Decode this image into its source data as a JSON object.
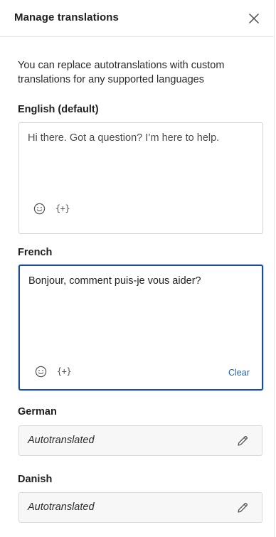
{
  "header": {
    "title": "Manage translations",
    "close_icon": "close-icon"
  },
  "intro": "You can replace autotranslations with custom translations for any supported languages",
  "english": {
    "label": "English (default)",
    "text": "Hi there. Got a question? I’m here to help.",
    "emoji_icon": "smiley-icon",
    "variable_icon_text": "{+}"
  },
  "french": {
    "label": "French",
    "text": "Bonjour, comment puis-je vous aider?",
    "emoji_icon": "smiley-icon",
    "variable_icon_text": "{+}",
    "clear_label": "Clear"
  },
  "german": {
    "label": "German",
    "value": "Autotranslated",
    "edit_icon": "pencil-icon"
  },
  "danish": {
    "label": "Danish",
    "value": "Autotranslated",
    "edit_icon": "pencil-icon"
  },
  "colors": {
    "accent": "#1a4f8e",
    "link": "#1a62b4",
    "border": "#d4d4d4",
    "readonly_bg": "#f7f7f7"
  }
}
